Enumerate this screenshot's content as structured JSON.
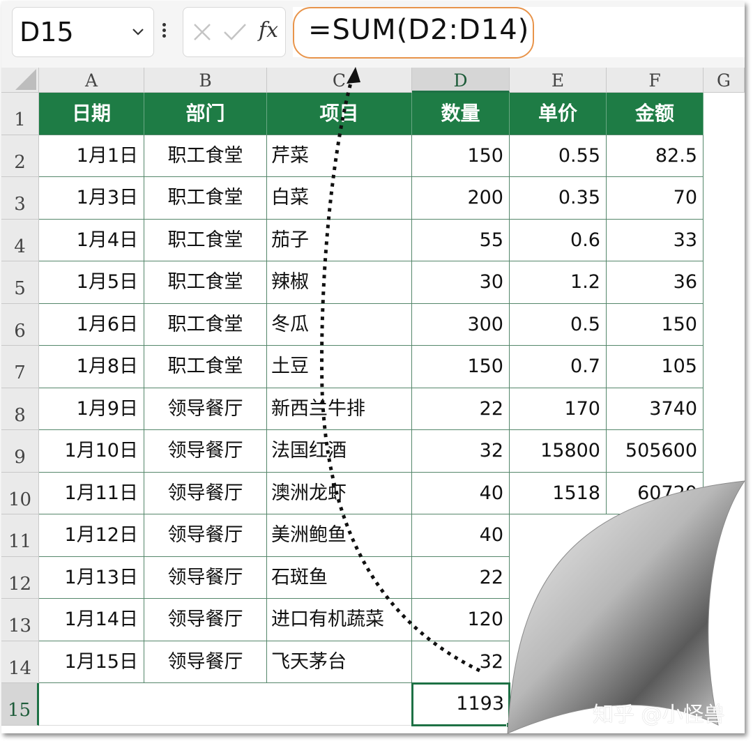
{
  "name_box": {
    "value": "D15"
  },
  "formula_bar": {
    "fx_label": "fx",
    "formula": "=SUM(D2:D14)"
  },
  "column_headers": [
    "A",
    "B",
    "C",
    "D",
    "E",
    "F",
    "G"
  ],
  "row_numbers": [
    "1",
    "2",
    "3",
    "4",
    "5",
    "6",
    "7",
    "8",
    "9",
    "10",
    "11",
    "12",
    "13",
    "14",
    "15"
  ],
  "table": {
    "headers": [
      "日期",
      "部门",
      "项目",
      "数量",
      "单价",
      "金额"
    ],
    "rows": [
      [
        "1月1日",
        "职工食堂",
        "芹菜",
        "150",
        "0.55",
        "82.5"
      ],
      [
        "1月3日",
        "职工食堂",
        "白菜",
        "200",
        "0.35",
        "70"
      ],
      [
        "1月4日",
        "职工食堂",
        "茄子",
        "55",
        "0.6",
        "33"
      ],
      [
        "1月5日",
        "职工食堂",
        "辣椒",
        "30",
        "1.2",
        "36"
      ],
      [
        "1月6日",
        "职工食堂",
        "冬瓜",
        "300",
        "0.5",
        "150"
      ],
      [
        "1月8日",
        "职工食堂",
        "土豆",
        "150",
        "0.7",
        "105"
      ],
      [
        "1月9日",
        "领导餐厅",
        "新西兰牛排",
        "22",
        "170",
        "3740"
      ],
      [
        "1月10日",
        "领导餐厅",
        "法国红酒",
        "32",
        "15800",
        "505600"
      ],
      [
        "1月11日",
        "领导餐厅",
        "澳洲龙虾",
        "40",
        "1518",
        "60720"
      ],
      [
        "1月12日",
        "领导餐厅",
        "美洲鲍鱼",
        "40",
        "",
        ""
      ],
      [
        "1月13日",
        "领导餐厅",
        "石斑鱼",
        "22",
        "",
        ""
      ],
      [
        "1月14日",
        "领导餐厅",
        "进口有机蔬菜",
        "120",
        "",
        ""
      ],
      [
        "1月15日",
        "领导餐厅",
        "飞天茅台",
        "32",
        "",
        ""
      ]
    ],
    "total": "1193"
  },
  "watermark": "知乎 @小怪兽",
  "colors": {
    "header_green": "#1e7c45",
    "selection_green": "#1e7145",
    "formula_outline": "#e8944a"
  }
}
